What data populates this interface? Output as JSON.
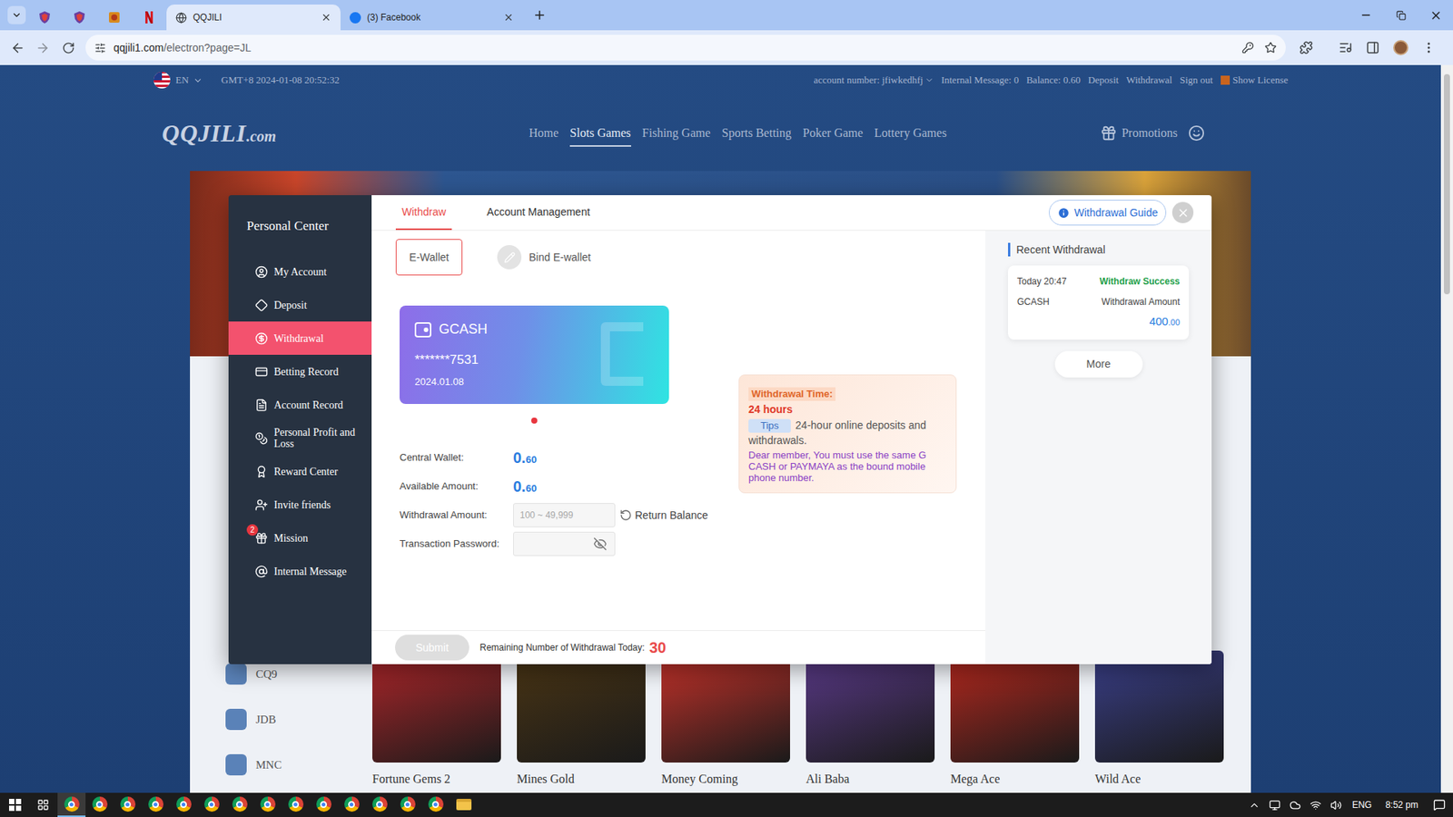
{
  "browser": {
    "pinned_tabs": [
      {
        "kind": "shield"
      },
      {
        "kind": "shield"
      },
      {
        "kind": "lantern"
      },
      {
        "kind": "netflix"
      }
    ],
    "tabs": [
      {
        "label": "QQJILI",
        "selected": true,
        "kind": "globe"
      },
      {
        "label": "(3) Facebook",
        "selected": false,
        "kind": "facebook"
      }
    ],
    "url": {
      "host": "qqjili1.com",
      "path": "/electron?page=JL"
    }
  },
  "top_bar": {
    "language": "EN",
    "clock": "GMT+8 2024-01-08 20:52:32",
    "account": "account number: jfiwkedhfj",
    "internal_message": "Internal Message: 0",
    "balance": "Balance: 0.60",
    "links": [
      "Deposit",
      "Withdrawal",
      "Sign out"
    ],
    "license": "Show License"
  },
  "logo": {
    "main": "QQJILI",
    "suffix": ".com"
  },
  "nav": [
    {
      "label": "Home",
      "selected": false
    },
    {
      "label": "Slots Games",
      "selected": true
    },
    {
      "label": "Fishing Game",
      "selected": false
    },
    {
      "label": "Sports Betting",
      "selected": false
    },
    {
      "label": "Poker Game",
      "selected": false
    },
    {
      "label": "Lottery Games",
      "selected": false
    }
  ],
  "promotions": "Promotions",
  "providers": [
    "CQ9",
    "JDB",
    "MNC"
  ],
  "games": [
    {
      "name": "Fortune Gems 2",
      "color": "#b0262a"
    },
    {
      "name": "Mines Gold",
      "color": "#4a3514"
    },
    {
      "name": "Money Coming",
      "color": "#c8322a"
    },
    {
      "name": "Ali Baba",
      "color": "#5b3a8a"
    },
    {
      "name": "Mega Ace",
      "color": "#b8281e"
    },
    {
      "name": "Wild Ace",
      "color": "#3a3f8a"
    }
  ],
  "modal": {
    "title": "Personal Center",
    "menu": [
      {
        "label": "My Account",
        "selected": false
      },
      {
        "label": "Deposit",
        "selected": false
      },
      {
        "label": "Withdrawal",
        "selected": true
      },
      {
        "label": "Betting Record",
        "selected": false
      },
      {
        "label": "Account Record",
        "selected": false
      },
      {
        "label": "Personal Profit and Loss",
        "selected": false
      },
      {
        "label": "Reward Center",
        "selected": false
      },
      {
        "label": "Invite friends",
        "selected": false
      },
      {
        "label": "Mission",
        "selected": false,
        "badge": "2"
      },
      {
        "label": "Internal Message",
        "selected": false
      }
    ],
    "tabs": [
      {
        "label": "Withdraw",
        "selected": true
      },
      {
        "label": "Account Management",
        "selected": false
      }
    ],
    "guide": "Withdrawal Guide",
    "wallet_types": [
      {
        "label": "E-Wallet",
        "selected": true
      }
    ],
    "bind": "Bind E-wallet",
    "card": {
      "name": "GCASH",
      "number": "*******7531",
      "date": "2024.01.08"
    },
    "card_dots": [
      {
        "selected": true
      }
    ],
    "central_wallet": {
      "label": "Central Wallet:",
      "whole": "0.",
      "fraction": "60"
    },
    "available": {
      "label": "Available Amount:",
      "whole": "0.",
      "fraction": "60"
    },
    "amount": {
      "label": "Withdrawal Amount:",
      "placeholder": "100 ~ 49,999",
      "action": "Return Balance"
    },
    "password": {
      "label": "Transaction Password:"
    },
    "notice": {
      "heading": "Withdrawal Time:",
      "hours": "24 hours",
      "tag": "Tips",
      "tip": "24-hour online deposits and withdrawals.",
      "warning": "Dear member, You must use the same G CASH or PAYMAYA as the bound mobile phone number."
    },
    "recent": {
      "title": "Recent Withdrawal",
      "items": [
        {
          "time": "Today 20:47",
          "status": "Withdraw Success",
          "method": "GCASH",
          "label": "Withdrawal Amount",
          "whole": "400",
          "fraction": ".00"
        }
      ],
      "more": "More"
    },
    "submit": {
      "label": "Submit",
      "disabled": true
    },
    "remaining": {
      "label": "Remaining Number of Withdrawal Today:",
      "count": "30"
    }
  },
  "scrollbar": {
    "position": 0,
    "thumb_share": 0.31
  },
  "taskbar": {
    "apps": [
      {
        "kind": "chrome",
        "active": true
      },
      {
        "kind": "chrome",
        "active": false
      },
      {
        "kind": "chrome",
        "active": false
      },
      {
        "kind": "chrome",
        "active": false
      },
      {
        "kind": "chrome",
        "active": false
      },
      {
        "kind": "chrome",
        "active": false
      },
      {
        "kind": "chrome",
        "active": false
      },
      {
        "kind": "chrome",
        "active": false
      },
      {
        "kind": "chrome",
        "active": false
      },
      {
        "kind": "chrome",
        "active": false
      },
      {
        "kind": "chrome",
        "active": false
      },
      {
        "kind": "chrome",
        "active": false
      },
      {
        "kind": "chrome",
        "active": false
      },
      {
        "kind": "chrome",
        "active": false
      },
      {
        "kind": "folder",
        "active": false
      }
    ],
    "language": "ENG",
    "time": "8:52 pm"
  }
}
